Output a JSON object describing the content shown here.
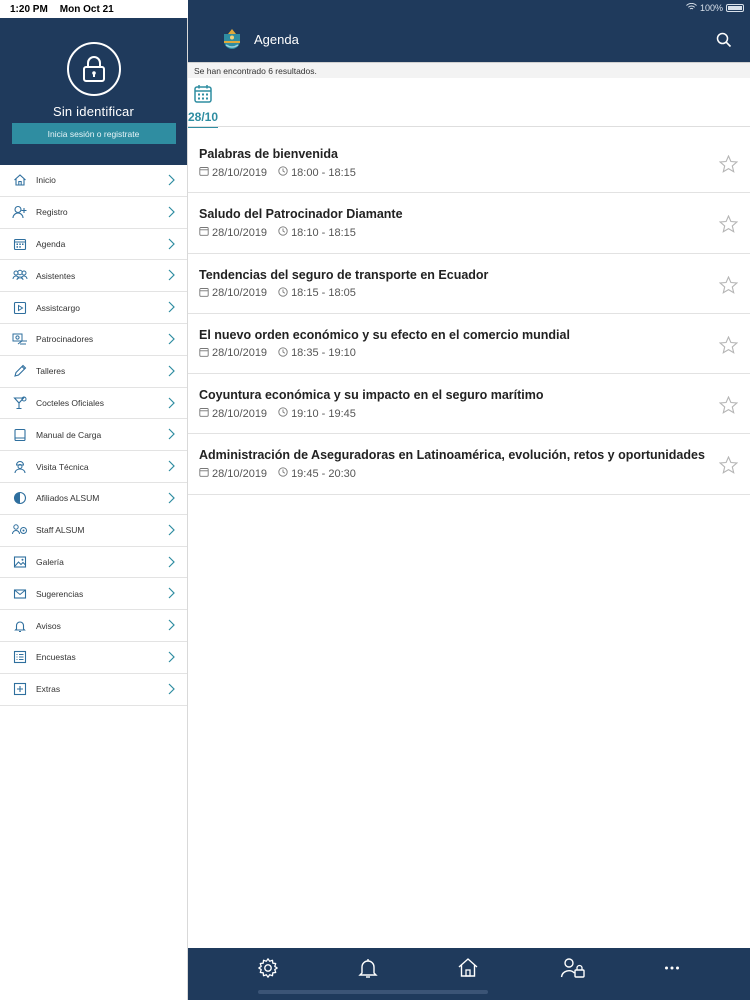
{
  "status": {
    "time": "1:20 PM",
    "date": "Mon Oct 21",
    "battery": "100%"
  },
  "drawer": {
    "user_name": "Sin identificar",
    "login_label": "Inicia sesión o registrate",
    "items": [
      {
        "label": "Inicio",
        "icon": "home-icon"
      },
      {
        "label": "Registro",
        "icon": "add-user-icon"
      },
      {
        "label": "Agenda",
        "icon": "calendar-icon"
      },
      {
        "label": "Asistentes",
        "icon": "people-icon"
      },
      {
        "label": "Assistcargo",
        "icon": "play-icon"
      },
      {
        "label": "Patrocinadores",
        "icon": "handshake-icon"
      },
      {
        "label": "Talleres",
        "icon": "pencil-icon"
      },
      {
        "label": "Cocteles Oficiales",
        "icon": "cocktail-icon"
      },
      {
        "label": "Manual de Carga",
        "icon": "book-icon"
      },
      {
        "label": "Visita Técnica",
        "icon": "worker-icon"
      },
      {
        "label": "Afiliados ALSUM",
        "icon": "half-circle-icon"
      },
      {
        "label": "Staff ALSUM",
        "icon": "staff-icon"
      },
      {
        "label": "Galería",
        "icon": "image-icon"
      },
      {
        "label": "Sugerencias",
        "icon": "mail-icon"
      },
      {
        "label": "Avisos",
        "icon": "bell-icon"
      },
      {
        "label": "Encuestas",
        "icon": "list-icon"
      },
      {
        "label": "Extras",
        "icon": "plus-box-icon"
      }
    ]
  },
  "header": {
    "title": "Agenda"
  },
  "results_text": "Se han encontrado 6 resultados.",
  "date_tab": {
    "label": "28/10"
  },
  "sessions": [
    {
      "title": "Palabras de bienvenida",
      "date": "28/10/2019",
      "time": "18:00 - 18:15"
    },
    {
      "title": "Saludo del Patrocinador Diamante",
      "date": "28/10/2019",
      "time": "18:10 - 18:15"
    },
    {
      "title": "Tendencias del seguro de transporte en Ecuador",
      "date": "28/10/2019",
      "time": "18:15 - 18:05"
    },
    {
      "title": "El nuevo orden económico y su efecto en el comercio mundial",
      "date": "28/10/2019",
      "time": "18:35 - 19:10"
    },
    {
      "title": "Coyuntura económica y su impacto en el seguro marítimo",
      "date": "28/10/2019",
      "time": "19:10 - 19:45"
    },
    {
      "title": "Administración de Aseguradoras en Latinoamérica, evolución, retos y oportunidades",
      "date": "28/10/2019",
      "time": "19:45 - 20:30"
    }
  ],
  "bottom_bar": [
    {
      "icon": "gear-icon"
    },
    {
      "icon": "bell-icon"
    },
    {
      "icon": "home-icon"
    },
    {
      "icon": "user-lock-icon"
    },
    {
      "icon": "more-icon"
    }
  ],
  "colors": {
    "navy": "#1f3a5c",
    "teal": "#2f8da1"
  }
}
